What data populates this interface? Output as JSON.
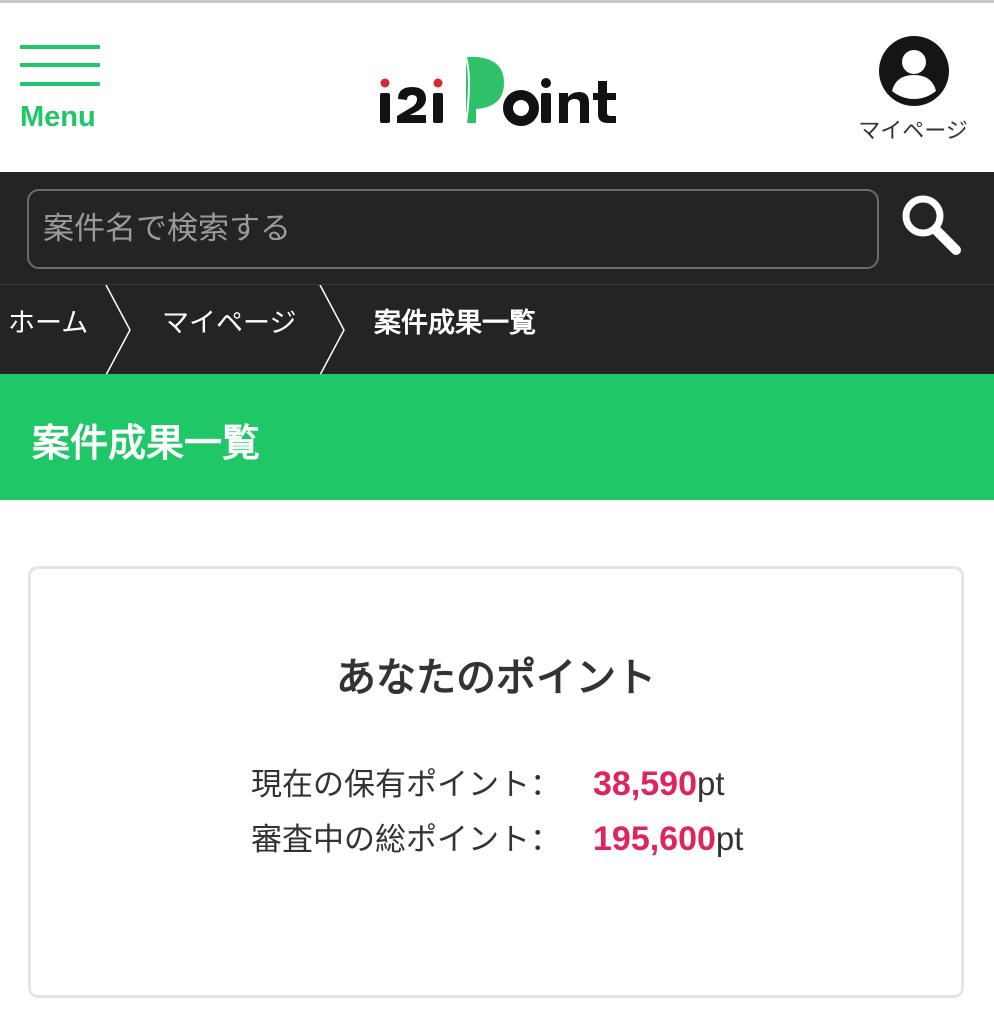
{
  "header": {
    "menu_label": "Menu",
    "logo_text": "i2i Point",
    "mypage_label": "マイページ",
    "icons": {
      "menu": "hamburger-icon",
      "account": "user-circle-icon"
    }
  },
  "search": {
    "placeholder": "案件名で検索する",
    "icon": "search-icon"
  },
  "breadcrumb": {
    "items": [
      "ホーム",
      "マイページ",
      "案件成果一覧"
    ]
  },
  "section": {
    "title": "案件成果一覧"
  },
  "points": {
    "title": "あなたのポイント",
    "rows": [
      {
        "label": "現在の保有ポイント：",
        "value": "38,590",
        "unit": "pt"
      },
      {
        "label": "審査中の総ポイント：",
        "value": "195,600",
        "unit": "pt"
      }
    ]
  },
  "colors": {
    "brand_green": "#1fc766",
    "dark_bar": "#242424",
    "point_value": "#e0245e",
    "logo_red": "#d8283a"
  }
}
